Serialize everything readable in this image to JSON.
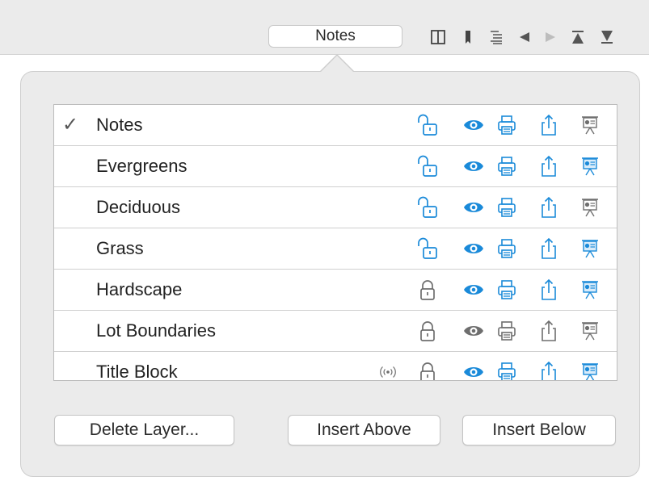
{
  "toolbar": {
    "tab_label": "Notes",
    "icons": [
      "split-view-icon",
      "bookmark-icon",
      "list-icon",
      "previous-icon",
      "next-icon",
      "first-icon",
      "last-icon"
    ]
  },
  "layers": {
    "rows": [
      {
        "name": "Notes",
        "checked": true,
        "locked": false,
        "visible": true,
        "printable": true,
        "exportable": true,
        "presentation": false
      },
      {
        "name": "Evergreens",
        "checked": false,
        "locked": false,
        "visible": true,
        "printable": true,
        "exportable": true,
        "presentation": true
      },
      {
        "name": "Deciduous",
        "checked": false,
        "locked": false,
        "visible": true,
        "printable": true,
        "exportable": true,
        "presentation": false
      },
      {
        "name": "Grass",
        "checked": false,
        "locked": false,
        "visible": true,
        "printable": true,
        "exportable": true,
        "presentation": true
      },
      {
        "name": "Hardscape",
        "checked": false,
        "locked": true,
        "visible": true,
        "printable": true,
        "exportable": true,
        "presentation": true
      },
      {
        "name": "Lot Boundaries",
        "checked": false,
        "locked": true,
        "visible": false,
        "printable": false,
        "exportable": false,
        "presentation": false
      },
      {
        "name": "Title Block",
        "checked": false,
        "locked": true,
        "visible": true,
        "printable": true,
        "exportable": true,
        "presentation": true,
        "shared": true
      }
    ],
    "check_glyph": "✓"
  },
  "buttons": {
    "delete": "Delete Layer...",
    "insert_above": "Insert Above",
    "insert_below": "Insert Below"
  },
  "colors": {
    "accent": "#1a8ad9",
    "inactive": "#6e6e6e"
  }
}
